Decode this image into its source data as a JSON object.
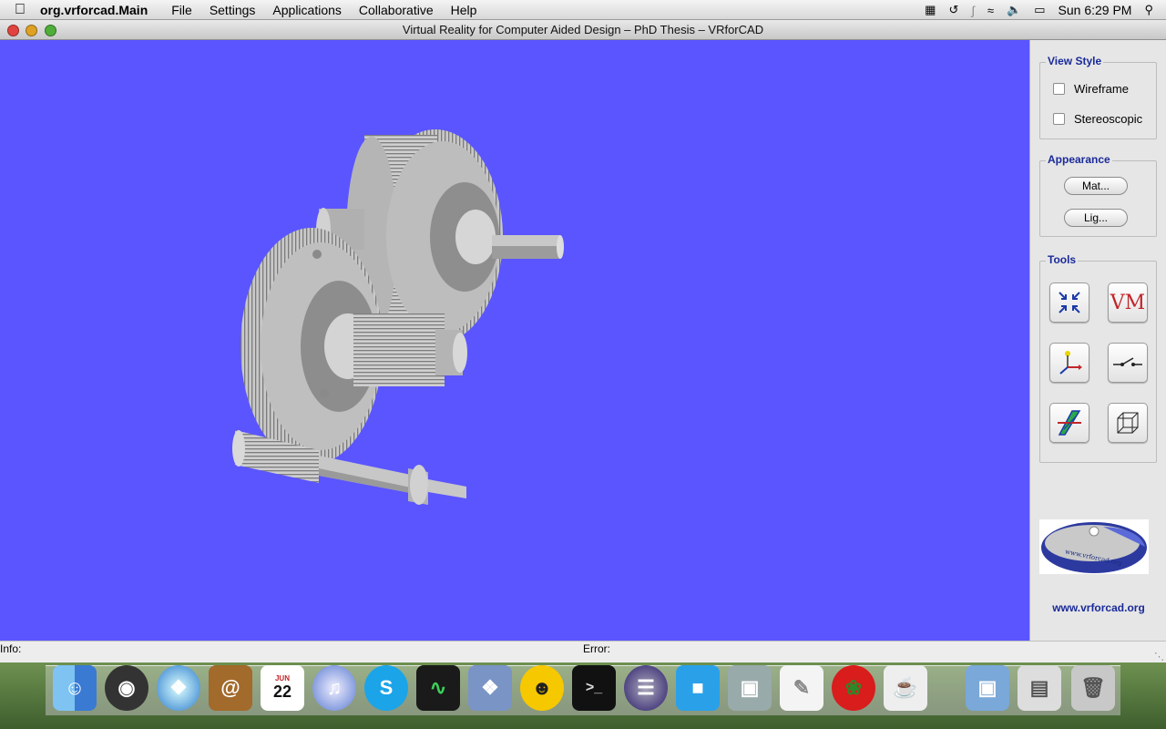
{
  "menubar": {
    "app_name": "org.vrforcad.Main",
    "items": [
      "File",
      "Settings",
      "Applications",
      "Collaborative",
      "Help"
    ],
    "clock": "Sun 6:29 PM"
  },
  "window": {
    "title": "Virtual Reality for Computer Aided Design – PhD Thesis  – VRforCAD"
  },
  "viewport": {
    "background": "#5a55ff"
  },
  "sidebar": {
    "view_style": {
      "legend": "View Style",
      "wireframe": "Wireframe",
      "stereoscopic": "Stereoscopic"
    },
    "appearance": {
      "legend": "Appearance",
      "material_button": "Mat...",
      "lighting_button": "Lig..."
    },
    "tools": {
      "legend": "Tools",
      "icons": [
        "fit-to-view-icon",
        "vm-icon",
        "axes-icon",
        "switch-icon",
        "section-plane-icon",
        "bounding-box-icon"
      ],
      "vm_label": "VM"
    },
    "logo_text": "www.vrforcad.org",
    "url": "www.vrforcad.org"
  },
  "status": {
    "info_label": "Info:",
    "error_label": "Error:"
  },
  "dock": {
    "apps": [
      "finder-icon",
      "dashboard-icon",
      "safari-icon",
      "address-book-icon",
      "ical-icon",
      "itunes-icon",
      "skype-icon",
      "activity-monitor-icon",
      "preview-icon",
      "yahoo-messenger-icon",
      "terminal-icon",
      "eclipse-icon",
      "app-icon",
      "iphoto-icon",
      "textedit-icon",
      "app-icon-2",
      "java-icon",
      "applications-folder-icon",
      "documents-stack-icon",
      "trash-icon"
    ],
    "ical_month": "JUN",
    "ical_day": "22"
  }
}
